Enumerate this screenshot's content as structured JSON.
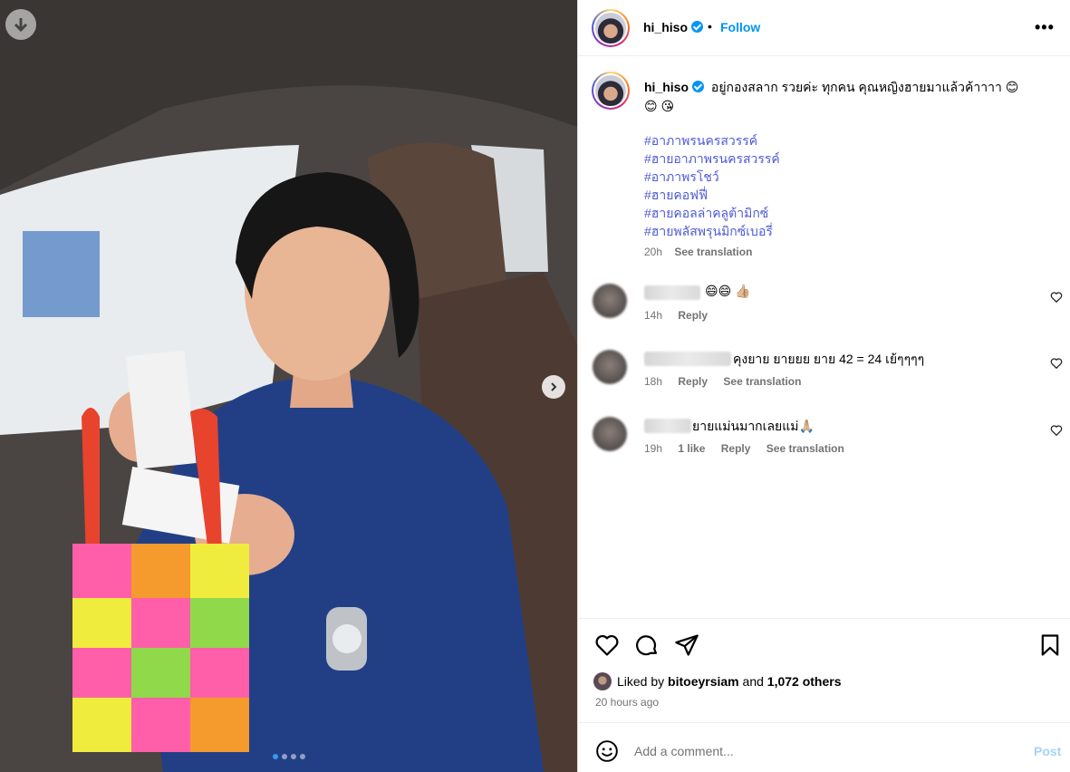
{
  "post": {
    "username": "hi_hiso",
    "follow_label": "Follow",
    "separator": "•",
    "more_label": "•••"
  },
  "caption": {
    "username": "hi_hiso",
    "text": "อยู่กองสลาก รวยค่ะ ทุกคน คุณหญิงฮายมาแล้วค้าาาา 😊",
    "text_line2": "😊 😘",
    "hashtags": [
      "#อาภาพรนครสวรรค์",
      "#ฮายอาภาพรนครสวรรค์",
      "#อาภาพรโชว์",
      "#ฮายคอฟฟี่",
      "#ฮายคอลล่าคลูต้ามิกซ์",
      "#ฮายพลัสพรุนมิกซ์เบอรี่"
    ],
    "time": "20h",
    "see_translation": "See translation"
  },
  "comments": [
    {
      "text": "😄😄 👍🏼",
      "time": "14h",
      "likes": "",
      "reply": "Reply",
      "translation": ""
    },
    {
      "text": "คุงยาย ยายยย ยาย 42 = 24 เย้ๆๆๆๆ",
      "time": "18h",
      "likes": "",
      "reply": "Reply",
      "translation": "See translation"
    },
    {
      "text": "ยายแม่นมากเลยแม่🙏🏼",
      "time": "19h",
      "likes": "1 like",
      "reply": "Reply",
      "translation": "See translation"
    }
  ],
  "likes": {
    "prefix": "Liked by",
    "user": "bitoeyrsiam",
    "joiner": "and",
    "others": "1,072 others"
  },
  "timestamp": "20 hours ago",
  "add_comment": {
    "placeholder": "Add a comment...",
    "post_label": "Post"
  },
  "carousel": {
    "slide_count": 4,
    "active_index": 0
  },
  "colors": {
    "accent": "#0095f6",
    "hashtag": "#4f5bd5",
    "muted": "#737373",
    "post_disabled": "#a5d2fb"
  }
}
